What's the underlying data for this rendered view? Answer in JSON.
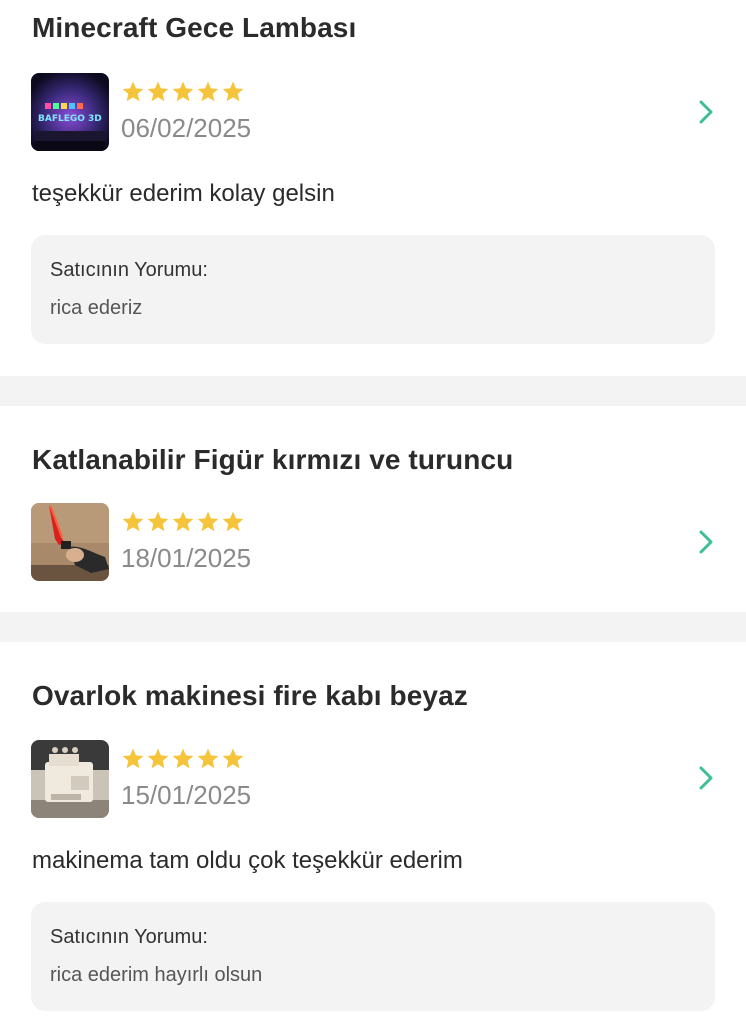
{
  "colors": {
    "star": "#f5c43a",
    "chevron": "#3dbf95",
    "page_bg": "#f3f3f3",
    "reply_bg": "#f3f3f3"
  },
  "reviews": [
    {
      "product_title": "Minecraft Gece Lambası",
      "rating": 5,
      "date": "06/02/2025",
      "comment": "teşekkür ederim kolay gelsin",
      "seller_reply_label": "Satıcının Yorumu:",
      "seller_reply": "rica ederiz",
      "thumbnail_icon": "lamp-product-image",
      "thumbnail_text": "BAFLEGO 3D"
    },
    {
      "product_title": "Katlanabilir Figür kırmızı ve turuncu",
      "rating": 5,
      "date": "18/01/2025",
      "thumbnail_icon": "figure-product-image"
    },
    {
      "product_title": "Ovarlok makinesi fire kabı beyaz",
      "rating": 5,
      "date": "15/01/2025",
      "comment": "makinema tam oldu çok teşekkür ederim",
      "seller_reply_label": "Satıcının Yorumu:",
      "seller_reply": "rica ederim hayırlı olsun",
      "thumbnail_icon": "sewing-machine-product-image"
    }
  ]
}
